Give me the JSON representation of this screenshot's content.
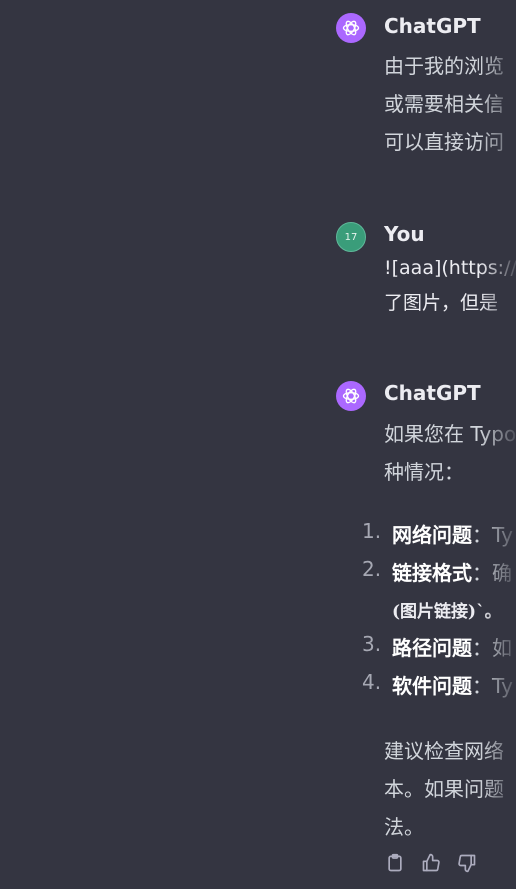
{
  "messages": [
    {
      "author": "ChatGPT",
      "avatar": "openai-logo-icon",
      "lines": [
        "由于我的浏览",
        "或需要相关信",
        "可以直接访问"
      ]
    },
    {
      "author": "You",
      "avatar_text": "17",
      "lines": [
        "![aaa](https://c",
        "了图片，但是"
      ]
    },
    {
      "author": "ChatGPT",
      "avatar": "openai-logo-icon",
      "intro_lines": [
        "如果您在 Typo",
        "种情况："
      ],
      "list": [
        {
          "num": "1.",
          "title": "网络问题",
          "rest": "：Ty"
        },
        {
          "num": "2.",
          "title": "链接格式",
          "rest": "：确",
          "sub": "(图片链接)`。"
        },
        {
          "num": "3.",
          "title": "路径问题",
          "rest": "：如"
        },
        {
          "num": "4.",
          "title": "软件问题",
          "rest": "：Ty"
        }
      ],
      "outro_lines": [
        "建议检查网络",
        "本。如果问题",
        "法。"
      ]
    }
  ],
  "actions": [
    "clipboard-icon",
    "thumbs-up-icon",
    "thumbs-down-icon"
  ],
  "colors": {
    "background": "#343541",
    "gpt_avatar": "#ab68ff",
    "user_avatar": "#3a9d7a",
    "text": "#d1d5db"
  }
}
